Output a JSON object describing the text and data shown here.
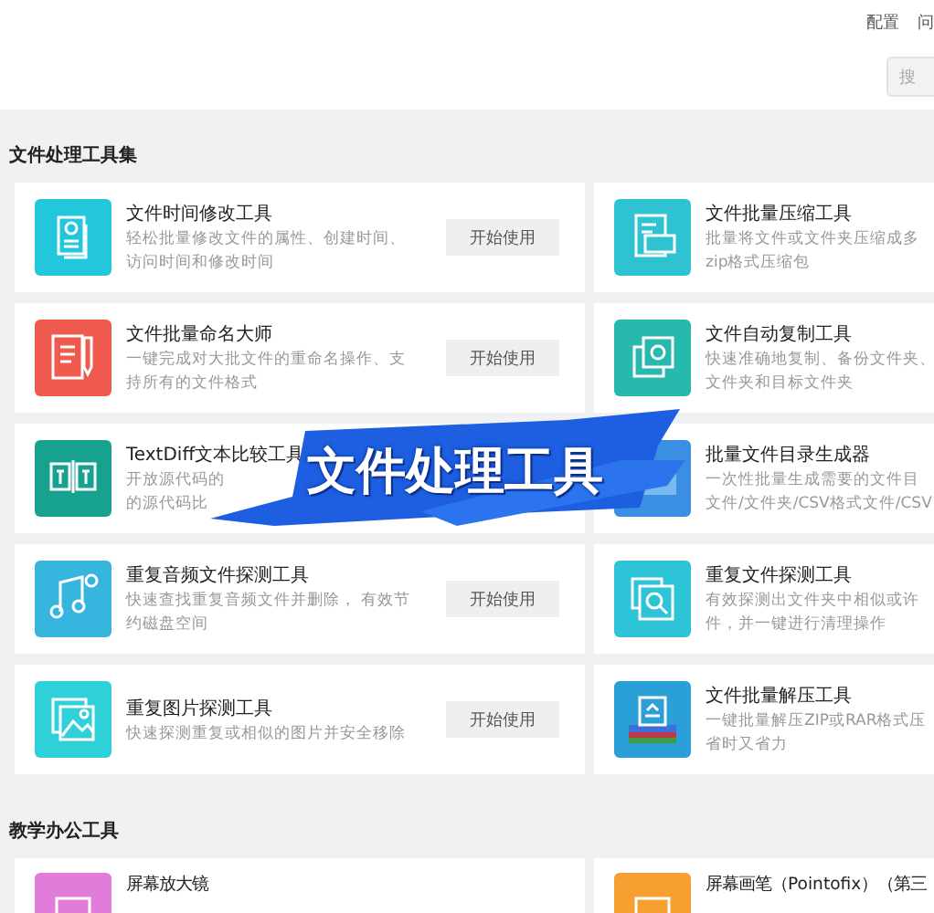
{
  "top_links": [
    "配置",
    "问"
  ],
  "search": {
    "placeholder": "搜"
  },
  "sections": [
    {
      "title": "文件处理工具集",
      "rows": [
        [
          {
            "color": "#22c7dc",
            "title": "文件时间修改工具",
            "desc": [
              "轻松批量修改文件的属性、创建时间、",
              "访问时间和修改时间"
            ],
            "button": "开始使用"
          },
          {
            "color": "#2fc3d2",
            "title": "文件批量压缩工具",
            "desc": [
              "批量将文件或文件夹压缩成多",
              "zip格式压缩包"
            ]
          }
        ],
        [
          {
            "color": "#ee5a4e",
            "title": "文件批量命名大师",
            "desc": [
              "一键完成对大批文件的重命名操作、支",
              "持所有的文件格式"
            ],
            "button": "开始使用"
          },
          {
            "color": "#27b9ae",
            "title": "文件自动复制工具",
            "desc": [
              "快速准确地复制、备份文件夹、",
              "文件夹和目标文件夹"
            ]
          }
        ],
        [
          {
            "color": "#17a28f",
            "title": "TextDiff文本比较工具",
            "desc": [
              "开放源代码的",
              "的源代码比"
            ]
          },
          {
            "color": "#3b8fe2",
            "title": "批量文件目录生成器",
            "desc": [
              "一次性批量生成需要的文件目",
              "文件/文件夹/CSV格式文件/CSV"
            ]
          }
        ],
        [
          {
            "color": "#36b6df",
            "title": "重复音频文件探测工具",
            "desc": [
              "快速查找重复音频文件并删除， 有效节",
              "约磁盘空间"
            ],
            "button": "开始使用"
          },
          {
            "color": "#2cc4d6",
            "title": "重复文件探测工具",
            "desc": [
              "有效探测出文件夹中相似或许",
              "件，并一键进行清理操作"
            ]
          }
        ],
        [
          {
            "color": "#30d0d8",
            "title": "重复图片探测工具",
            "desc": [
              "快速探测重复或相似的图片并安全移除"
            ],
            "button": "开始使用"
          },
          {
            "color": "#2a9fd8",
            "title": "文件批量解压工具",
            "desc": [
              "一键批量解压ZIP或RAR格式压",
              "省时又省力"
            ]
          }
        ]
      ]
    },
    {
      "title": "教学办公工具",
      "rows": [
        [
          {
            "color": "#e27cd9",
            "title": "屏幕放大镜"
          },
          {
            "color": "#f7a031",
            "title": "屏幕画笔（Pointofix）（第三"
          }
        ]
      ]
    }
  ],
  "caption": "文件处理工具"
}
